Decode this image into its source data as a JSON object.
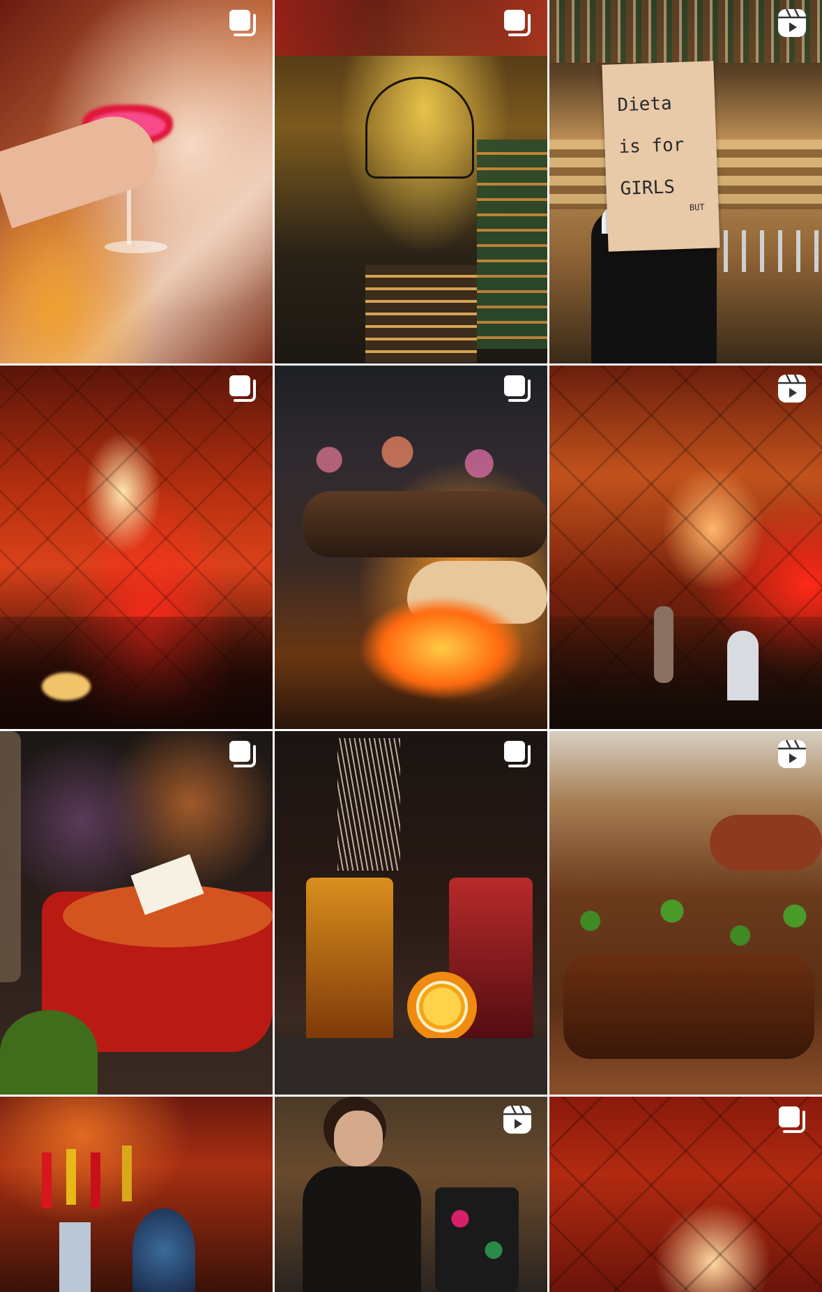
{
  "grid": {
    "posts": [
      {
        "id": "cocktail",
        "type": "carousel",
        "scene": "hand holding red cocktail coupe"
      },
      {
        "id": "vaulted-bar",
        "type": "carousel",
        "scene": "painted vaulted ceiling with chandelier and bar shelves"
      },
      {
        "id": "bartender-sign",
        "type": "reel",
        "scene": "bartender holding cardboard sign"
      },
      {
        "id": "red-hall",
        "type": "carousel",
        "scene": "red ornate ceiling hall"
      },
      {
        "id": "skewer",
        "type": "carousel",
        "scene": "grilled meat skewer over flames"
      },
      {
        "id": "red-chandelier",
        "type": "reel",
        "scene": "ornate hall with glowing chandelier"
      },
      {
        "id": "soup-pot",
        "type": "carousel",
        "scene": "red pot with meatballs and parmesan"
      },
      {
        "id": "mulled-drinks",
        "type": "carousel",
        "scene": "mason jar drinks with orange slices"
      },
      {
        "id": "meat-platter",
        "type": "reel",
        "scene": "grilled ribs and sausages platter"
      },
      {
        "id": "flags-hall",
        "type": "none",
        "scene": "hall with flags and round window"
      },
      {
        "id": "woman-dancing",
        "type": "reel",
        "scene": "woman in black top smiling"
      },
      {
        "id": "ceiling-glow",
        "type": "carousel",
        "scene": "red ornate ceiling with light"
      }
    ],
    "sign_text": {
      "line1": "Dieta",
      "line2": "is  for",
      "line3": "GIRLS",
      "line4": "BUT"
    },
    "colors": {
      "warm_red": "#b3200e",
      "gold": "#d99a2b",
      "dark": "#1a0d08",
      "badge": "#ffffff"
    },
    "icons": {
      "carousel": "carousel-icon",
      "reel": "reel-icon"
    }
  }
}
